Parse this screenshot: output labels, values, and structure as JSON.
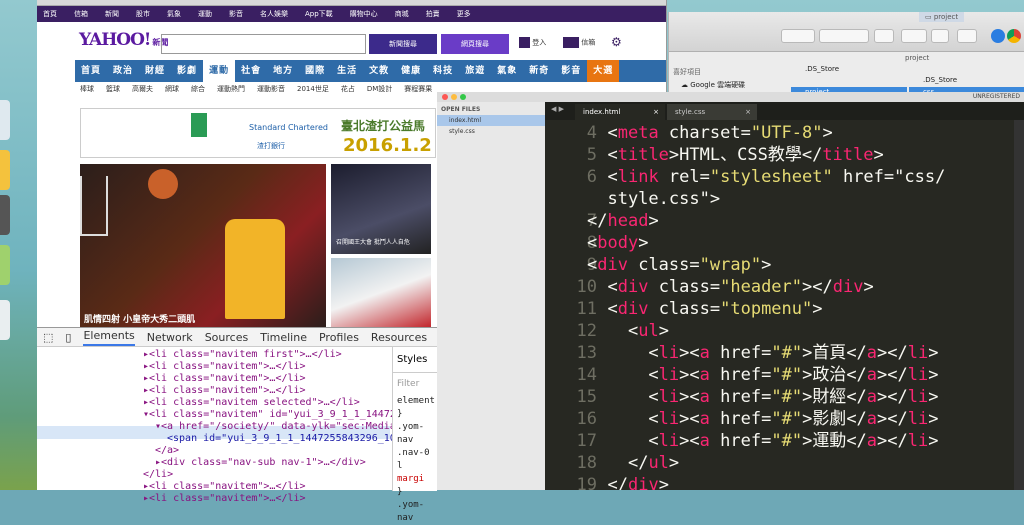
{
  "finder": {
    "title": "project",
    "tab_label": "project",
    "sidebar_label": "喜好項目",
    "sidebar_item": "Google 雲端硬碟",
    "col1_selected": "project",
    "col2_item1": ".DS_Store",
    "col2_selected": "css",
    "col1_item": ".DS_Store"
  },
  "browser": {
    "yahoo_nav": [
      "首頁",
      "信箱",
      "新聞",
      "股市",
      "氣象",
      "運動",
      "影音",
      "名人娛樂",
      "App下載",
      "購物中心",
      "商城",
      "拍賣",
      "更多"
    ],
    "logo": "YAHOO!",
    "logo_sub": "奇摩",
    "logo_tag": "新聞",
    "btn_news": "新聞搜尋",
    "btn_web": "網頁搜尋",
    "login": "登入",
    "mail": "信箱",
    "menu": [
      "首頁",
      "政治",
      "財經",
      "影劇",
      "運動",
      "社會",
      "地方",
      "國際",
      "生活",
      "文教",
      "健康",
      "科技",
      "旅遊",
      "氣象",
      "新奇",
      "影音",
      "大選"
    ],
    "submenu": [
      "棒球",
      "籃球",
      "高爾夫",
      "網球",
      "綜合",
      "運動熱門",
      "運動影音",
      "2014世足",
      "花占",
      "DM設計",
      "賽程賽果"
    ],
    "ad_brand": "Standard Chartered",
    "ad_brand_cn": "渣打銀行",
    "ad_title": "臺北渣打公益馬",
    "ad_date": "2016.1.2",
    "hero_caption": "肌情四射 小皇帝大秀二頭肌",
    "side_caption": "召開國王大會 批鬥人人自危"
  },
  "devtools": {
    "tabs": [
      "Elements",
      "Network",
      "Sources",
      "Timeline",
      "Profiles",
      "Resources"
    ],
    "styles_tab": "Styles",
    "filter": "Filter",
    "lines": [
      {
        "indent": 0,
        "text": "▸<li class=\"navitem first\">…</li>"
      },
      {
        "indent": 0,
        "text": "▸<li class=\"navitem\">…</li>"
      },
      {
        "indent": 0,
        "text": "▸<li class=\"navitem\">…</li>"
      },
      {
        "indent": 0,
        "text": "▸<li class=\"navitem\">…</li>"
      },
      {
        "indent": 0,
        "text": "▸<li class=\"navitem selected\">…</li>"
      },
      {
        "indent": 0,
        "text": "▾<li class=\"navitem\" id=\"yui_3_9_1_1_144725"
      },
      {
        "indent": 1,
        "text": "▾<a href=\"/society/\" data-ylk=\"sec:MediaN"
      },
      {
        "indent": 2,
        "text": "<span id=\"yui_3_9_1_1_1447255843296_10"
      },
      {
        "indent": 1,
        "text": "</a>"
      },
      {
        "indent": 1,
        "text": "▸<div class=\"nav-sub nav-1\">…</div>"
      },
      {
        "indent": 0,
        "text": "</li>"
      },
      {
        "indent": 0,
        "text": "▸<li class=\"navitem\">…</li>"
      },
      {
        "indent": 0,
        "text": "▸<li class=\"navitem\">…</li>"
      }
    ],
    "style_lines": [
      "element.",
      "}",
      ".yom-nav",
      ".nav-0 l",
      "margi",
      "}",
      ".yom-nav"
    ]
  },
  "sublime": {
    "sidebar_header": "OPEN FILES",
    "files": [
      "index.html",
      "style.css"
    ],
    "tabs": [
      "index.html",
      "style.css"
    ],
    "unregistered": "UNREGISTERED",
    "line_numbers": [
      "4",
      "5",
      "6",
      "",
      "7",
      "8",
      "9",
      "10",
      "11",
      "12",
      "13",
      "14",
      "15",
      "16",
      "17",
      "18",
      "19"
    ],
    "code": [
      "  <meta charset=\"UTF-8\">",
      "  <title>HTML、CSS教學</title>",
      "  <link rel=\"stylesheet\" href=\"css/",
      "  style.css\">",
      "</head>",
      "<body>",
      "<div class=\"wrap\">",
      "  <div class=\"header\"></div>",
      "  <div class=\"topmenu\">",
      "    <ul>",
      "      <li><a href=\"#\">首頁</a></li>",
      "      <li><a href=\"#\">政治</a></li>",
      "      <li><a href=\"#\">財經</a></li>",
      "      <li><a href=\"#\">影劇</a></li>",
      "      <li><a href=\"#\">運動</a></li>",
      "    </ul>",
      "  </div>"
    ]
  },
  "colors": {
    "yahoo_purple": "#3a1f62",
    "menu_blue": "#2f6ba8",
    "editor_bg": "#272822"
  }
}
